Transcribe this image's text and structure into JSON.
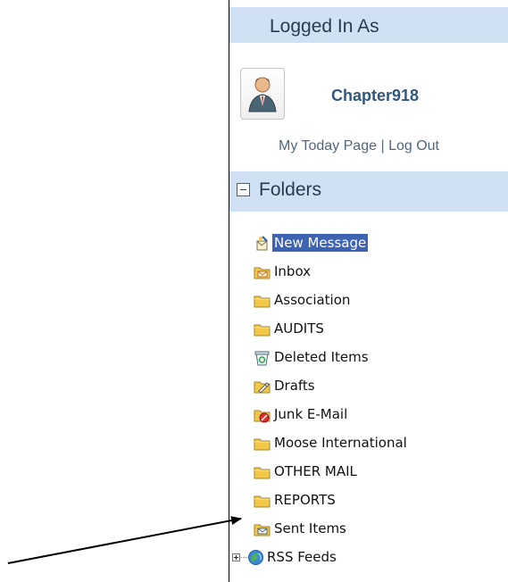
{
  "logged_in": {
    "header_title": "Logged In As",
    "username": "Chapter918",
    "my_today_page": "My Today Page",
    "separator": "|",
    "log_out": "Log Out"
  },
  "folders": {
    "header_title": "Folders",
    "items": [
      {
        "label": "New Message",
        "icon": "new-message-icon",
        "selected": true
      },
      {
        "label": "Inbox",
        "icon": "inbox-folder-icon"
      },
      {
        "label": "Association",
        "icon": "folder-icon"
      },
      {
        "label": "AUDITS",
        "icon": "folder-icon"
      },
      {
        "label": "Deleted Items",
        "icon": "deleted-items-icon"
      },
      {
        "label": "Drafts",
        "icon": "drafts-icon"
      },
      {
        "label": "Junk E-Mail",
        "icon": "junk-email-icon"
      },
      {
        "label": "Moose International",
        "icon": "folder-icon"
      },
      {
        "label": "OTHER MAIL",
        "icon": "folder-icon"
      },
      {
        "label": "REPORTS",
        "icon": "folder-icon"
      },
      {
        "label": "Sent Items",
        "icon": "sent-items-icon"
      },
      {
        "label": "RSS Feeds",
        "icon": "rss-feeds-icon"
      }
    ]
  },
  "colors": {
    "header_background": "#cfe1f3",
    "header_text": "#283b52",
    "username": "#31577f",
    "selected_background": "#3f63b3",
    "folder_yellow": "#f2c84b"
  }
}
